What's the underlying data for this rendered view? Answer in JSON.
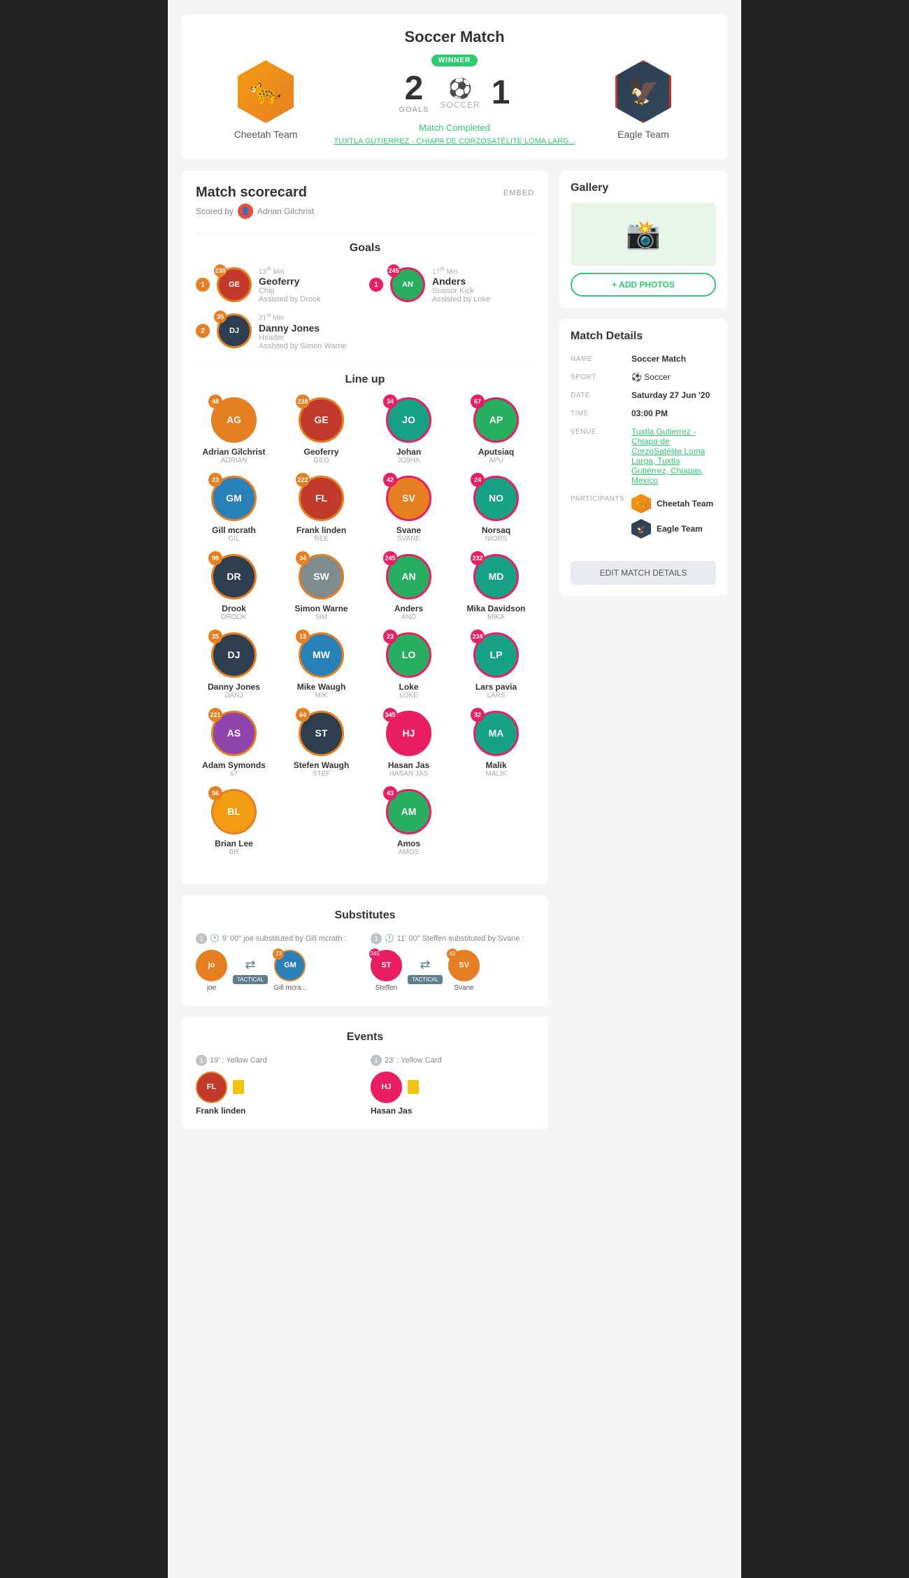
{
  "page": {
    "title": "Soccer Match"
  },
  "header": {
    "match_title": "Soccer Match",
    "team1": {
      "name": "Cheetah Team",
      "score": "2",
      "goals_label": "GOALS",
      "winner": true,
      "winner_text": "WINNER",
      "hex_icon": "🐆"
    },
    "team2": {
      "name": "Eagle Team",
      "score": "1",
      "hex_icon": "🦅"
    },
    "sport": "SOCCER",
    "status": "Match Completed",
    "location": "TUXTLA GUTIERREZ - CHIAPA DE CORZOSATÉLITE LOMA LARG..."
  },
  "scorecard": {
    "title": "Match scorecard",
    "embed_label": "EMBED",
    "scored_by_label": "Scored by",
    "scorer_name": "Adrian Gilchrist",
    "goals_title": "Goals",
    "goals": [
      {
        "team": 1,
        "number": 1,
        "minute": "13",
        "minute_sup": "th",
        "player": "Geoferry",
        "type": "Chip",
        "assist": "Assisted by Drook",
        "avatar_color": "av-red",
        "avatar_initials": "GE",
        "num_overlay": "238"
      },
      {
        "team": 2,
        "number": 1,
        "minute": "17",
        "minute_sup": "th",
        "player": "Anders",
        "type": "Scissor Kick",
        "assist": "Assisted by Loke",
        "avatar_color": "av-green",
        "avatar_initials": "AN",
        "num_overlay": "245"
      },
      {
        "team": 1,
        "number": 2,
        "minute": "21",
        "minute_sup": "st",
        "player": "Danny Jones",
        "type": "Header",
        "assist": "Assisted by Simon Warne",
        "avatar_color": "av-dark",
        "avatar_initials": "DJ",
        "num_overlay": "35"
      }
    ],
    "lineup_title": "Line up",
    "players": [
      {
        "name": "Adrian Gilchrist",
        "code": "ADRIAN",
        "num": "48",
        "team": 1,
        "avatar": "av-orange",
        "initials": "AG"
      },
      {
        "name": "Geoferry",
        "code": "GEO",
        "num": "238",
        "team": 1,
        "avatar": "av-red",
        "initials": "GE"
      },
      {
        "name": "Johan",
        "code": "JO9HA",
        "num": "34",
        "team": 2,
        "avatar": "av-teal",
        "initials": "JO"
      },
      {
        "name": "Aputsiaq",
        "code": "APU",
        "num": "67",
        "team": 2,
        "avatar": "av-green",
        "initials": "AP"
      },
      {
        "name": "Gill mcrath",
        "code": "GIL",
        "num": "23",
        "team": 1,
        "avatar": "av-blue",
        "initials": "GM"
      },
      {
        "name": "Frank linden",
        "code": "REE",
        "num": "222",
        "team": 1,
        "avatar": "av-red",
        "initials": "FL"
      },
      {
        "name": "Svane",
        "code": "SVANE",
        "num": "42",
        "team": 2,
        "avatar": "av-orange",
        "initials": "SV"
      },
      {
        "name": "Norsaq",
        "code": "NIORS",
        "num": "24",
        "team": 2,
        "avatar": "av-teal",
        "initials": "NO"
      },
      {
        "name": "Drook",
        "code": "DROOK",
        "num": "99",
        "team": 1,
        "avatar": "av-dark",
        "initials": "DR"
      },
      {
        "name": "Simon Warne",
        "code": "SIM",
        "num": "34",
        "team": 1,
        "avatar": "av-gray",
        "initials": "SW"
      },
      {
        "name": "Anders",
        "code": "AND",
        "num": "245",
        "team": 2,
        "avatar": "av-green",
        "initials": "AN"
      },
      {
        "name": "Mika Davidson",
        "code": "MIKA",
        "num": "232",
        "team": 2,
        "avatar": "av-teal",
        "initials": "MD"
      },
      {
        "name": "Danny Jones",
        "code": "DANj",
        "num": "35",
        "team": 1,
        "avatar": "av-dark",
        "initials": "DJ"
      },
      {
        "name": "Mike Waugh",
        "code": "MIK",
        "num": "13",
        "team": 1,
        "avatar": "av-blue",
        "initials": "MW"
      },
      {
        "name": "Loke",
        "code": "LOKE",
        "num": "23",
        "team": 2,
        "avatar": "av-green",
        "initials": "LO"
      },
      {
        "name": "Lars pavia",
        "code": "LARS",
        "num": "234",
        "team": 2,
        "avatar": "av-teal",
        "initials": "LP"
      },
      {
        "name": "Adam Symonds",
        "code": "67",
        "num": "221",
        "team": 1,
        "avatar": "av-purple",
        "initials": "AS"
      },
      {
        "name": "Stefen Waugh",
        "code": "STEF",
        "num": "64",
        "team": 1,
        "avatar": "av-dark",
        "initials": "ST"
      },
      {
        "name": "Hasan Jas",
        "code": "HASAN JAS",
        "num": "345",
        "team": 2,
        "avatar": "av-pink",
        "initials": "HJ"
      },
      {
        "name": "Malik",
        "code": "MALIK",
        "num": "32",
        "team": 2,
        "avatar": "av-teal",
        "initials": "MA"
      },
      {
        "name": "Brian Lee",
        "code": "BR",
        "num": "56",
        "team": 1,
        "avatar": "av-yellow",
        "initials": "BL"
      },
      {
        "name": "Amos",
        "code": "AMOS",
        "num": "43",
        "team": 2,
        "avatar": "av-green",
        "initials": "AM"
      }
    ],
    "substitutes_title": "Substitutes",
    "substitutes": [
      {
        "team": 1,
        "time": "9' 00\"",
        "description": "joe substituted by Gill mcrath :",
        "out_player": "joe",
        "out_initials": "jo",
        "out_avatar": "av-orange",
        "in_player": "Gill mcra...",
        "in_initials": "GM",
        "in_avatar": "av-blue",
        "in_num": "23",
        "tactical": "TACTICAL"
      },
      {
        "team": 1,
        "time": "11' 00\"",
        "description": "Steffen substituted by Svane :",
        "out_player": "Steffen",
        "out_initials": "ST",
        "out_avatar": "av-dark",
        "out_num": "345",
        "in_player": "Svane",
        "in_initials": "SV",
        "in_avatar": "av-orange",
        "in_num": "42",
        "tactical": "TACTICAL"
      }
    ],
    "events_title": "Events",
    "events": [
      {
        "team": 1,
        "minute": "19'",
        "type": "Yellow Card",
        "player": "Frank linden",
        "avatar": "av-red",
        "initials": "FL",
        "border_class": "event-avatar"
      },
      {
        "team": 1,
        "minute": "23'",
        "type": "Yellow Card",
        "player": "Hasan Jas",
        "avatar": "av-pink",
        "initials": "HJ",
        "border_class": "event-avatar pink"
      }
    ]
  },
  "gallery": {
    "title": "Gallery",
    "add_photos_label": "+ ADD PHOTOS"
  },
  "match_details": {
    "title": "Match Details",
    "name_label": "NAME",
    "name_value": "Soccer Match",
    "sport_label": "SPORT",
    "sport_value": "Soccer",
    "date_label": "DATE",
    "date_value": "Saturday 27 Jun '20",
    "time_label": "TIME",
    "time_value": "03:00 PM",
    "venue_label": "VENUE",
    "venue_value": "Tuxtla Gutierrez - Chiapa de CorzoSatélite Loma Larga, Tuxtla Gutiérrez, Chiapas, Mexico",
    "participants_label": "PARTICIPANTS",
    "team1_name": "Cheetah Team",
    "team2_name": "Eagle Team",
    "edit_button": "EDIT MATCH DETAILS"
  }
}
